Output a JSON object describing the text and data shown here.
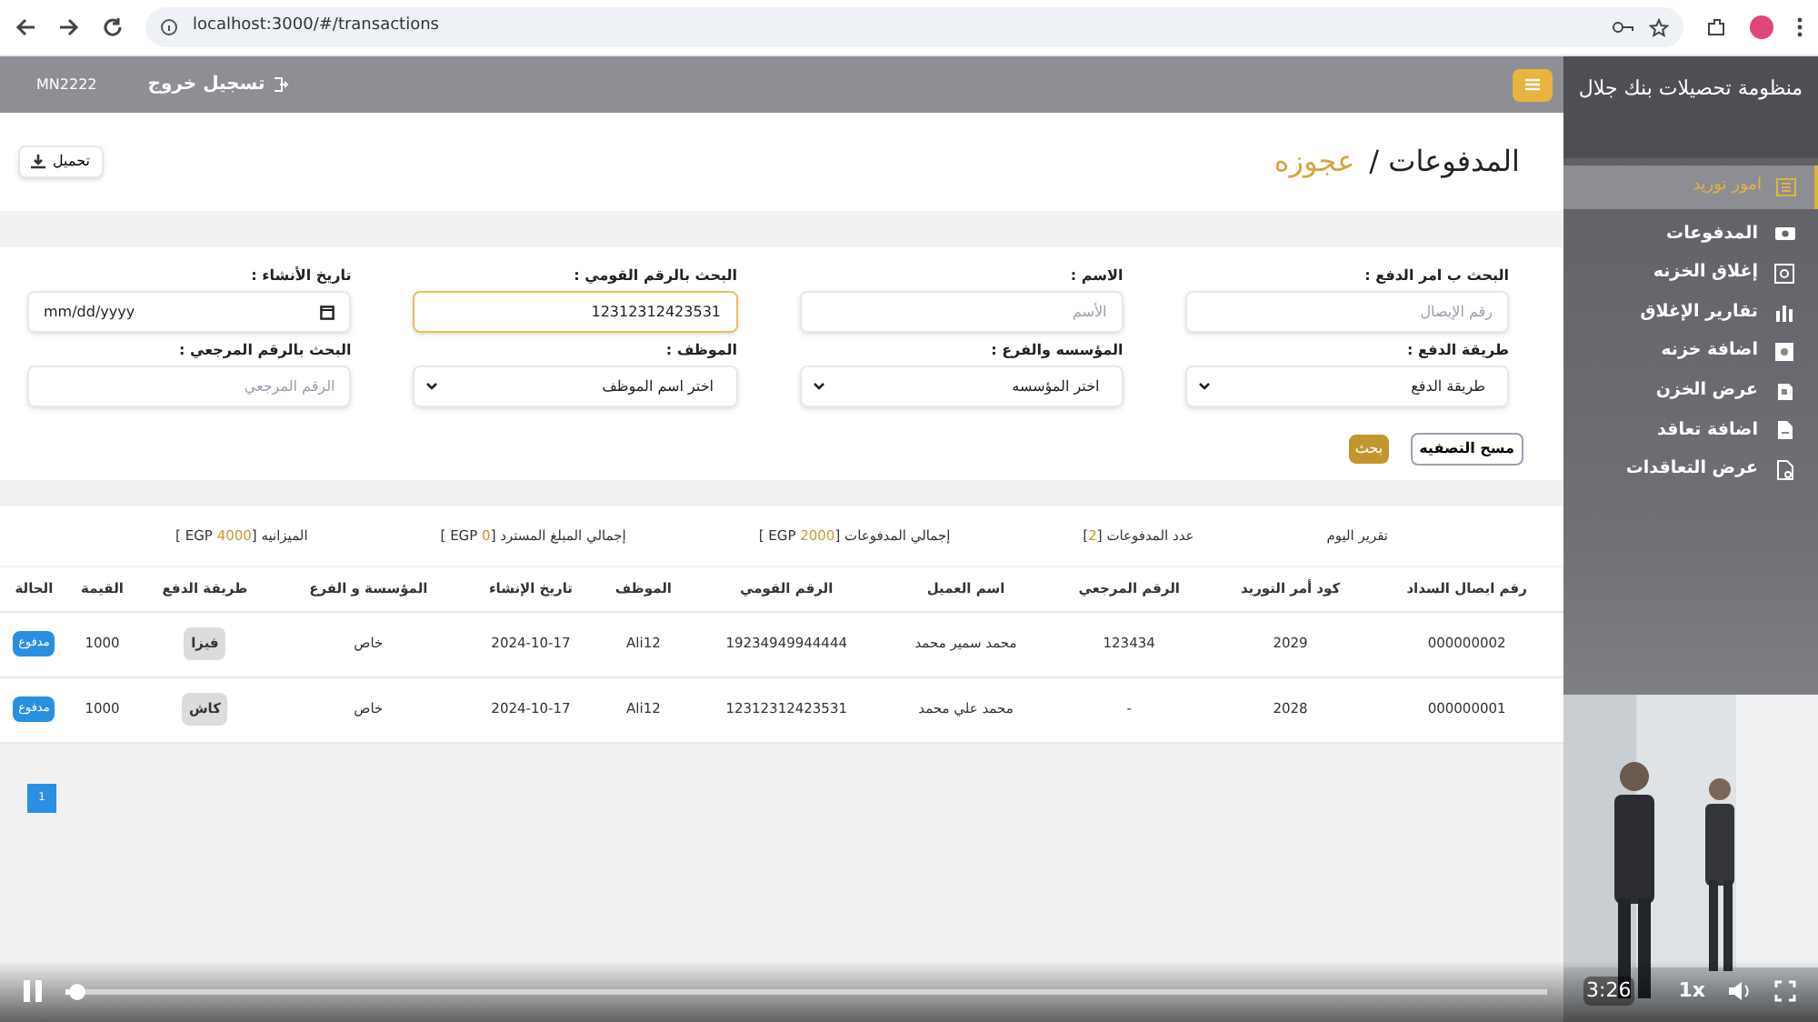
{
  "browser": {
    "url": "localhost:3000/#/transactions"
  },
  "topbar": {
    "logout": "تسجيل خروج",
    "user": "MN2222"
  },
  "sidebar": {
    "title": "منظومة تحصيلات بنك جلال",
    "items": [
      {
        "label": "امور توريد",
        "selected": true,
        "expanded": true,
        "children": [
          {
            "label": "المدفوعات",
            "selected": false
          },
          {
            "label": "إغلاق الخزنه",
            "selected": false
          },
          {
            "label": "تقارير الإغلاق",
            "selected": false
          },
          {
            "label": "اضافة خزنه",
            "selected": false
          },
          {
            "label": "عرض الخزن",
            "selected": false
          },
          {
            "label": "اضافة تعاقد",
            "selected": false
          },
          {
            "label": "عرض التعاقدات",
            "selected": false
          }
        ]
      }
    ]
  },
  "header": {
    "title": "المدفوعات /",
    "subtitle": "عجوزه",
    "download": "تحميل"
  },
  "filters": [
    {
      "kind": "text",
      "label": "البحث ب امر الدفع :",
      "placeholder": "رقم الإيصال"
    },
    {
      "kind": "text",
      "label": "الاسم :",
      "placeholder": "الأسم"
    },
    {
      "kind": "text",
      "label": "البحث بالرقم القومي :",
      "value": "12312312423531",
      "focused": true
    },
    {
      "kind": "date",
      "label": "تاريخ الأنشاء :",
      "placeholder": "mm/dd/yyyy"
    },
    {
      "kind": "select",
      "label": "طريقة الدفع :",
      "value": "طريقة الدفع"
    },
    {
      "kind": "select",
      "label": "المؤسسه والفرع :",
      "value": "اختر المؤسسه"
    },
    {
      "kind": "select",
      "label": "الموظف :",
      "value": "اختر اسم الموظف"
    },
    {
      "kind": "text",
      "label": "البحث بالرقم المرجعي :",
      "placeholder": "الرقم المرجعي"
    }
  ],
  "filter_buttons": {
    "clear": "مسح التصفيه",
    "search": "بحث"
  },
  "summary": [
    {
      "parts": [
        {
          "text": "تقرير اليوم"
        }
      ]
    },
    {
      "parts": [
        {
          "text": "عدد المدفوعات ["
        },
        {
          "text": "2",
          "highlight": true
        },
        {
          "text": "]"
        }
      ]
    },
    {
      "parts": [
        {
          "text": "إجمالي المدفوعات ["
        },
        {
          "text": "2000",
          "highlight": true
        },
        {
          "text": " EGP ]"
        }
      ]
    },
    {
      "parts": [
        {
          "text": "إجمالي المبلغ المسترد ["
        },
        {
          "text": "0",
          "highlight": true
        },
        {
          "text": " EGP ]"
        }
      ]
    },
    {
      "parts": [
        {
          "text": "الميزانيه ["
        },
        {
          "text": "4000",
          "highlight": true
        },
        {
          "text": " EGP ]"
        }
      ]
    }
  ],
  "table": {
    "columns": [
      "رقم ايصال السداد",
      "كود أمر التوريد",
      "الرقم المرجعي",
      "اسم العميل",
      "الرقم القومي",
      "الموظف",
      "تاريخ الإنشاء",
      "المؤسسة و الفرع",
      "طريقة الدفع",
      "القيمة",
      "الحالة"
    ],
    "rows": [
      [
        "000000002",
        "2029",
        "123434",
        "محمد سمير محمد",
        "19234949944444",
        "Ali12",
        "2024-10-17",
        "خاص",
        "فيزا",
        "1000",
        "مدفوع"
      ],
      [
        "000000001",
        "2028",
        "-",
        "محمد علي محمد",
        "12312312423531",
        "Ali12",
        "2024-10-17",
        "خاص",
        "كاش",
        "1000",
        "مدفوع"
      ]
    ]
  },
  "pagination": [
    {
      "label": "1",
      "selected": true
    }
  ],
  "player": {
    "playing": true,
    "level": 0.003,
    "time": "3:26",
    "speed": "1x"
  }
}
